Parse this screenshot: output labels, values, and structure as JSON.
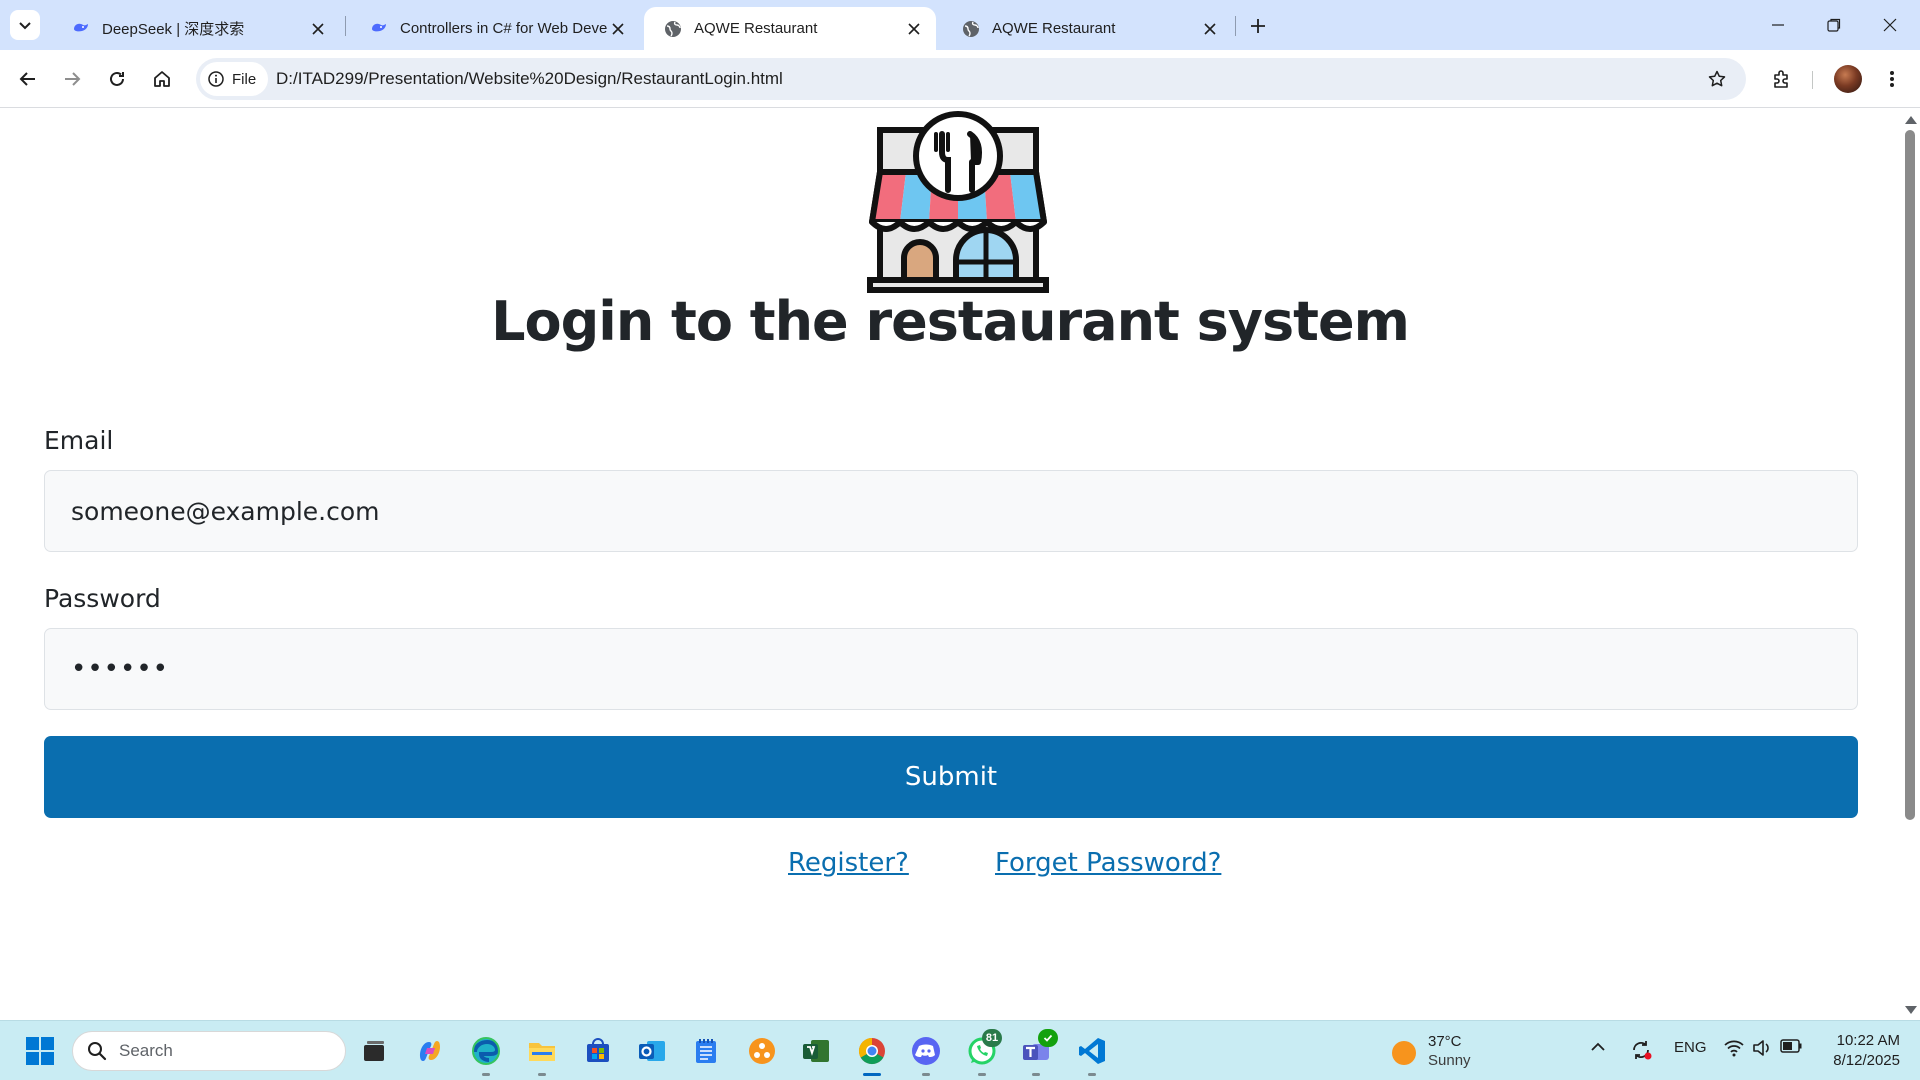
{
  "browser": {
    "tabs": [
      {
        "title": "DeepSeek | 深度求索",
        "favicon": "deepseek-icon",
        "active": false
      },
      {
        "title": "Controllers in C# for Web Devel",
        "favicon": "deepseek-icon",
        "active": false
      },
      {
        "title": "AQWE Restaurant",
        "favicon": "globe-icon",
        "active": true
      },
      {
        "title": "AQWE Restaurant",
        "favicon": "globe-icon",
        "active": false
      }
    ],
    "address": {
      "scheme_chip": "File",
      "url": "D:/ITAD299/Presentation/Website%20Design/RestaurantLogin.html"
    }
  },
  "page": {
    "logo": "restaurant-storefront-icon",
    "heading": "Login to the restaurant system",
    "email": {
      "label": "Email",
      "value": "someone@example.com"
    },
    "password": {
      "label": "Password",
      "value": "••••••"
    },
    "submit_label": "Submit",
    "links": {
      "register": "Register?",
      "forgot": "Forget Password?"
    },
    "colors": {
      "primary": "#0a6eaf",
      "heading": "#212529",
      "field_bg": "#f8f9fa"
    }
  },
  "taskbar": {
    "search_placeholder": "Search",
    "apps": [
      "file-explorer-icon",
      "copilot-icon",
      "edge-icon",
      "folder-icon",
      "store-icon",
      "outlook-icon",
      "notepad-icon",
      "app-icon",
      "project-icon",
      "chrome-icon",
      "discord-icon",
      "whatsapp-icon",
      "teams-icon",
      "vscode-icon"
    ],
    "whatsapp_badge": "81",
    "weather": {
      "temp": "37°C",
      "condition": "Sunny"
    },
    "language": "ENG",
    "time": "10:22 AM",
    "date": "8/12/2025"
  }
}
